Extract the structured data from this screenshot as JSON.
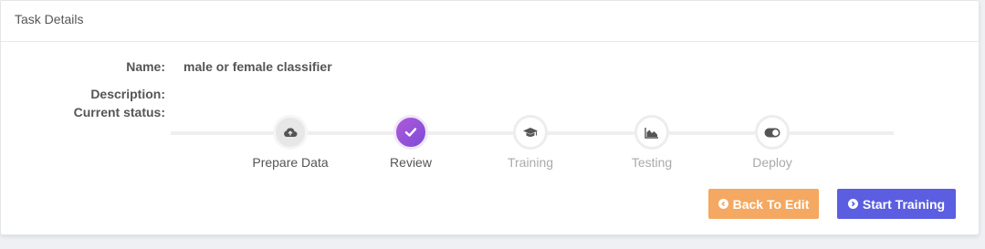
{
  "panel": {
    "title": "Task Details"
  },
  "fields": {
    "name_label": "Name:",
    "name_value": "male or female classifier",
    "description_label": "Description:",
    "description_value": "",
    "status_label": "Current status:"
  },
  "steps": [
    {
      "label": "Prepare Data",
      "icon": "cloud-upload-icon",
      "state": "done"
    },
    {
      "label": "Review",
      "icon": "check-icon",
      "state": "active"
    },
    {
      "label": "Training",
      "icon": "graduation-cap-icon",
      "state": "pending"
    },
    {
      "label": "Testing",
      "icon": "area-chart-icon",
      "state": "pending"
    },
    {
      "label": "Deploy",
      "icon": "toggle-icon",
      "state": "pending"
    }
  ],
  "actions": {
    "back_label": "Back To Edit",
    "start_label": "Start Training"
  },
  "colors": {
    "back_button": "#f4a861",
    "start_button": "#5b5ee0",
    "active_step": "#9a52d8"
  }
}
